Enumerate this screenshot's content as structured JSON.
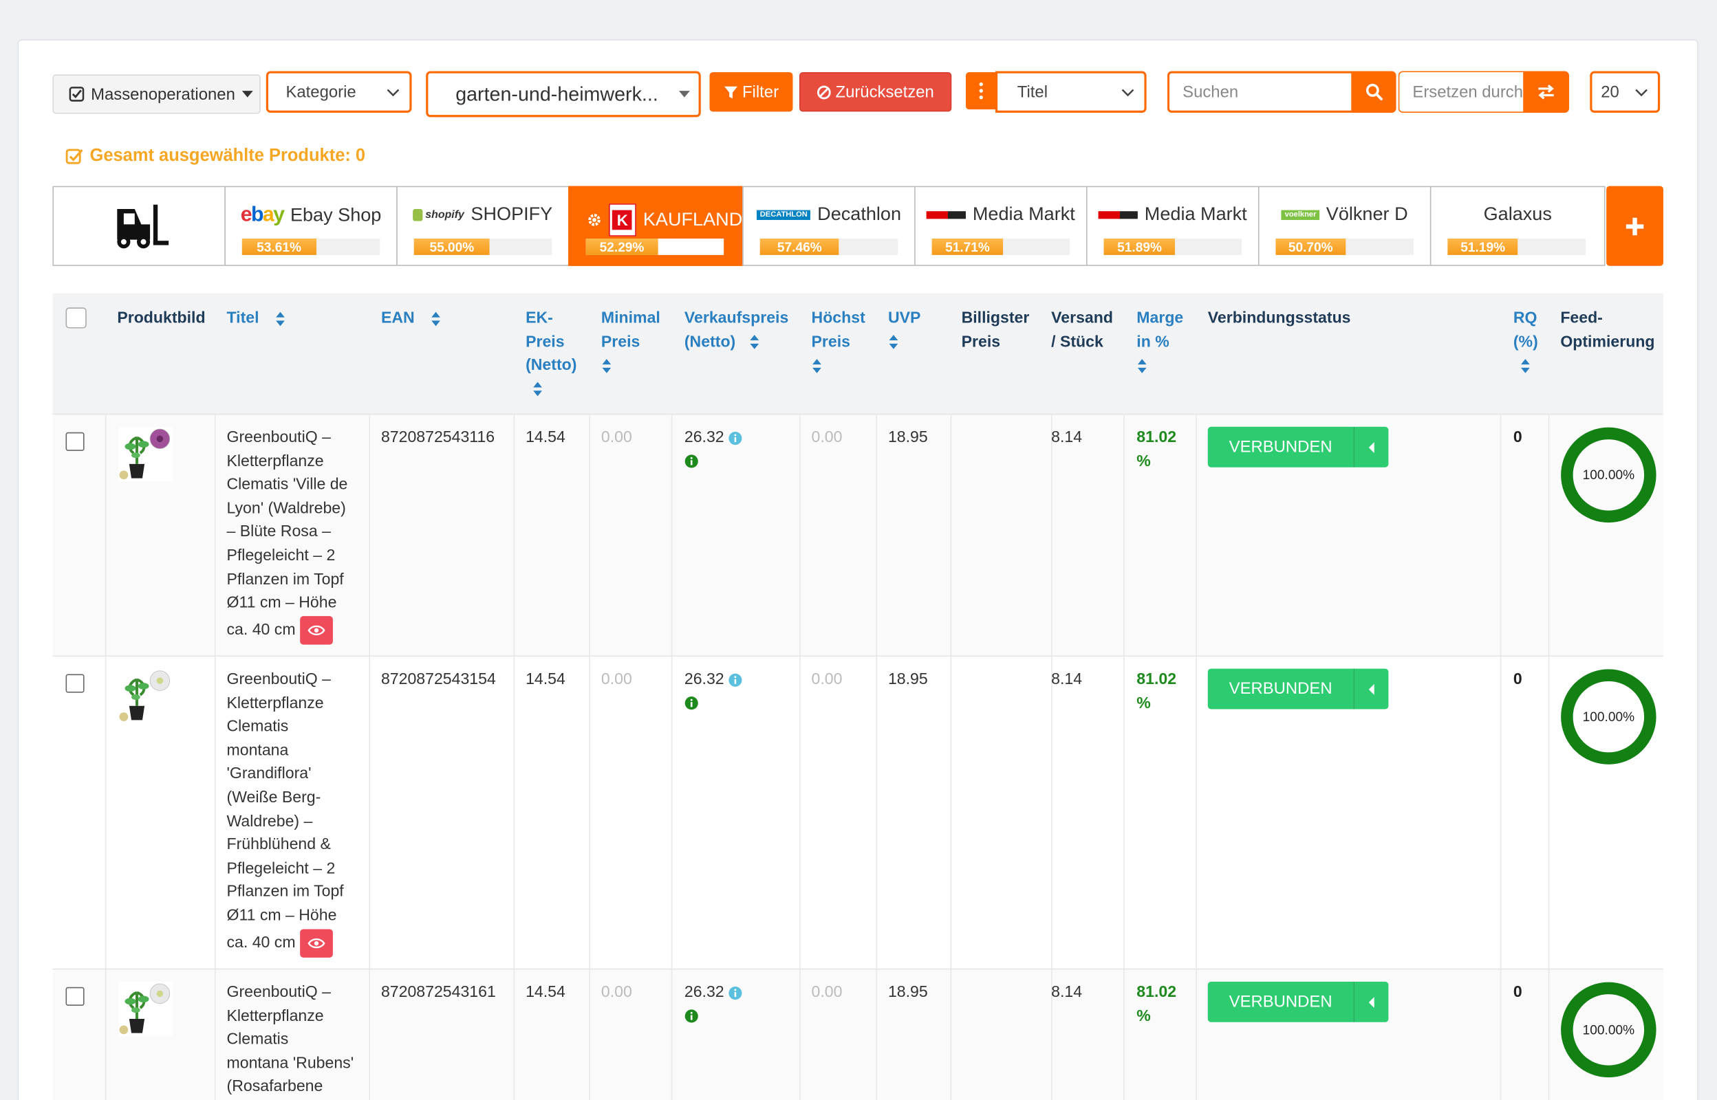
{
  "toolbar": {
    "mass_ops_label": "Massenoperationen",
    "category_select": "Kategorie",
    "category_value": "garten-und-heimwerk...",
    "filter_label": "Filter",
    "reset_label": "Zurücksetzen",
    "field_select": "Titel",
    "search_placeholder": "Suchen",
    "replace_placeholder": "Ersetzen durch",
    "page_size": "20"
  },
  "selected_info": "Gesamt ausgewählte Produkte: 0",
  "channels": [
    {
      "name": "",
      "percent": null,
      "icon": "forklift-icon"
    },
    {
      "name": "Ebay Shop",
      "percent": "53.61%",
      "fill": 0.5361,
      "logo": "ebay"
    },
    {
      "name": "SHOPIFY",
      "percent": "55.00%",
      "fill": 0.55,
      "logo": "shopify"
    },
    {
      "name": "KAUFLAND",
      "percent": "52.29%",
      "fill": 0.5229,
      "logo": "kaufland",
      "active": true
    },
    {
      "name": "Decathlon",
      "percent": "57.46%",
      "fill": 0.5746,
      "logo": "DECATHLON"
    },
    {
      "name": "Media Markt",
      "percent": "51.71%",
      "fill": 0.5171,
      "logo": "mediamarkt"
    },
    {
      "name": "Media Markt",
      "percent": "51.89%",
      "fill": 0.5189,
      "logo": "mediamarkt"
    },
    {
      "name": "Völkner D",
      "percent": "50.70%",
      "fill": 0.507,
      "logo": "voelkner"
    },
    {
      "name": "Galaxus",
      "percent": "51.19%",
      "fill": 0.5119,
      "logo": ""
    }
  ],
  "table": {
    "headers": {
      "bild": "Produktbild",
      "titel": "Titel",
      "ean": "EAN",
      "ek1": "EK-",
      "ek2": "Preis",
      "ek3": "(Netto)",
      "min1": "Minimal",
      "min2": "Preis",
      "vk1": "Verkaufspreis",
      "vk2": "(Netto)",
      "hoch1": "Höchst",
      "hoch2": "Preis",
      "uvp": "UVP",
      "bill1": "Billigster",
      "bill2": "Preis",
      "vers1": "Versand",
      "vers2": "/ Stück",
      "marge1": "Marge",
      "marge2": "in %",
      "status": "Verbindungsstatus",
      "rq1": "RQ",
      "rq2": "(%)",
      "feed1": "Feed-",
      "feed2": "Optimierung"
    },
    "rows": [
      {
        "title_lines": [
          "GreenboutiQ –",
          "Kletterpflanze",
          "Clematis 'Ville de",
          "Lyon' (Waldrebe)",
          "– Blüte Rosa –",
          "Pflegeleicht – 2",
          "Pflanzen im Topf",
          "Ø11 cm – Höhe",
          "ca. 40 cm"
        ],
        "ean": "8720872543116",
        "ek": "14.54",
        "min": "0.00",
        "vk": "26.32",
        "hoch": "0.00",
        "uvp": "18.95",
        "billig": "",
        "versand": "8.14",
        "marge_a": "81.02",
        "marge_b": "%",
        "status": "VERBUNDEN",
        "rq": "0",
        "feed": "100.00%"
      },
      {
        "title_lines": [
          "GreenboutiQ –",
          "Kletterpflanze",
          "Clematis",
          "montana",
          "'Grandiflora'",
          "(Weiße Berg-",
          "Waldrebe) –",
          "Frühblühend &",
          "Pflegeleicht – 2",
          "Pflanzen im Topf",
          "Ø11 cm – Höhe",
          "ca. 40 cm"
        ],
        "ean": "8720872543154",
        "ek": "14.54",
        "min": "0.00",
        "vk": "26.32",
        "hoch": "0.00",
        "uvp": "18.95",
        "billig": "",
        "versand": "8.14",
        "marge_a": "81.02",
        "marge_b": "%",
        "status": "VERBUNDEN",
        "rq": "0",
        "feed": "100.00%"
      },
      {
        "title_lines": [
          "GreenboutiQ –",
          "Kletterpflanze",
          "Clematis",
          "montana 'Rubens'",
          "(Rosafarbene"
        ],
        "ean": "8720872543161",
        "ek": "14.54",
        "min": "0.00",
        "vk": "26.32",
        "hoch": "0.00",
        "uvp": "18.95",
        "billig": "",
        "versand": "8.14",
        "marge_a": "81.02",
        "marge_b": "%",
        "status": "VERBUNDEN",
        "rq": "0",
        "feed": "100.00%"
      }
    ]
  },
  "colors": {
    "accent": "#ff6a00",
    "danger": "#e74c3c",
    "success": "#2ecc71",
    "header_link": "#2a7fc1",
    "marge": "#1e8a1e",
    "progress": "#f59a1a"
  }
}
